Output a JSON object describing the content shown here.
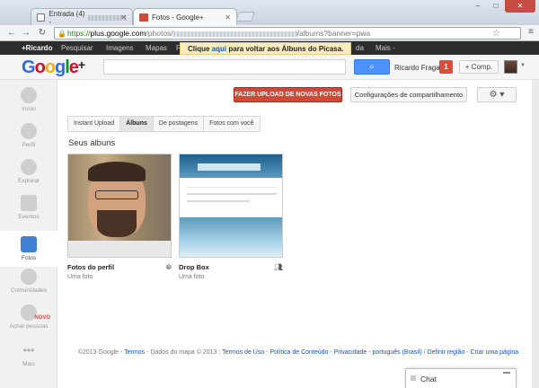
{
  "browser": {
    "tabs": [
      {
        "label": "Entrada (4) -",
        "favicon": "gmail-icon",
        "active": false
      },
      {
        "label": "Fotos - Google+",
        "favicon": "googleplus-icon",
        "active": true
      }
    ],
    "address": {
      "scheme": "https://",
      "host": "plus.google.com",
      "path_start": "/photos/",
      "path_end": "/albums?banner=pwa"
    }
  },
  "gbar": {
    "items": [
      "+Ricardo",
      "Pesquisar",
      "Imagens",
      "Mapas",
      "F",
      "da",
      "Mais -"
    ]
  },
  "notice": {
    "pre": "Clique ",
    "link": "aqui",
    "post": " para voltar aos Álbuns do Picasa."
  },
  "header": {
    "logo_text": "Google+",
    "search_button_icon": "search-icon",
    "username": "Ricardo Fraga",
    "notification_count": "1",
    "share_label": "+ Comp."
  },
  "leftnav": {
    "items": [
      {
        "label": "Início",
        "icon": "home-icon"
      },
      {
        "label": "Perfil",
        "icon": "profile-icon"
      },
      {
        "label": "Explorar",
        "icon": "explore-icon"
      },
      {
        "label": "Eventos",
        "icon": "calendar-icon"
      },
      {
        "label": "Fotos",
        "icon": "camera-icon",
        "active": true
      },
      {
        "label": "Comunidades",
        "icon": "communities-icon"
      },
      {
        "label": "Achar pessoas",
        "icon": "find-people-icon",
        "badge": "NOVO"
      },
      {
        "label": "Mais",
        "icon": "more-icon"
      }
    ]
  },
  "toolbar": {
    "upload_label": "FAZER UPLOAD DE NOVAS FOTOS",
    "share_settings_label": "Configurações de compartilhamento",
    "gear_icon": "gear-icon"
  },
  "photo_tabs": [
    "Instant Upload",
    "Álbuns",
    "De postagens",
    "Fotos com você"
  ],
  "albums_heading": "Seus álbuns",
  "albums": [
    {
      "name": "Fotos do perfil",
      "count": "Uma foto",
      "icon": "globe-icon"
    },
    {
      "name": "Drop Box",
      "count": "Uma foto",
      "icon": "people-icon"
    }
  ],
  "footer": {
    "copyright": "©2013 Google",
    "terms": "Termos",
    "map_data": "Dados do mapa © 2013",
    "terms_use": "Termos de Uso",
    "content_policy": "Política de Conteúdo",
    "privacy": "Privacidade",
    "language": "português (Brasil)",
    "region": "Definir região",
    "create_page": "Criar uma página"
  },
  "chat": {
    "label": "Chat"
  },
  "colors": {
    "accent_blue": "#4d90fe",
    "upload_red": "#d14836",
    "notice_yellow": "#f9edbe",
    "gbar_dark": "#2d2d2d"
  }
}
